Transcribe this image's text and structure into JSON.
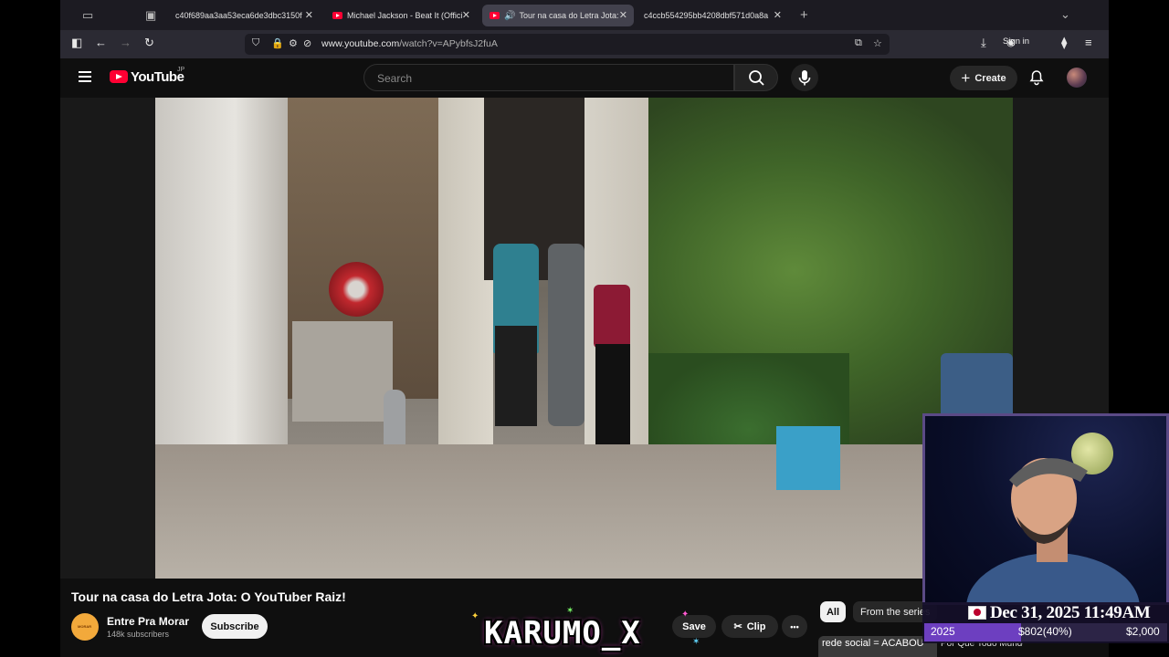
{
  "browser": {
    "tabs": [
      {
        "title": "c40f689aa3aa53eca6de3dbc3150f"
      },
      {
        "title": "Michael Jackson - Beat It (Offici"
      },
      {
        "title": "Tour na casa do Letra Jota:"
      },
      {
        "title": "c4ccb554295bb4208dbf571d0a8a"
      }
    ],
    "new_tab": "+",
    "url_host": "www.youtube.com",
    "url_path": "/watch?v=APybfsJ2fuA",
    "sign_in": "Sign in"
  },
  "youtube": {
    "logo_text": "YouTube",
    "region": "JP",
    "search_placeholder": "Search",
    "create_label": "Create"
  },
  "video": {
    "title": "Tour na casa do Letra Jota: O YouTuber Raiz!",
    "channel_name": "Entre Pra Morar",
    "channel_avatar_text": "MORAR",
    "subscribers": "148k subscribers",
    "subscribe_label": "Subscribe",
    "save_label": "Save",
    "clip_label": "Clip",
    "more_label": "•••"
  },
  "sidebar": {
    "chips": [
      "All",
      "From the series"
    ],
    "rec_title_a": "rede social = ACABOU",
    "rec_title_b": "Por Que Todo Mundo Tá Abandonando as Redes"
  },
  "overlay": {
    "brand": "KARUMO_X",
    "datetime": "Dec 31, 2025 11:49AM",
    "year": "2025",
    "amount": "$802(40%)",
    "goal": "$2,000",
    "progress_fraction": 0.4
  },
  "colors": {
    "youtube_red": "#ff0033",
    "overlay_purple": "#6d3fc0",
    "bg": "#0f0f0f"
  }
}
